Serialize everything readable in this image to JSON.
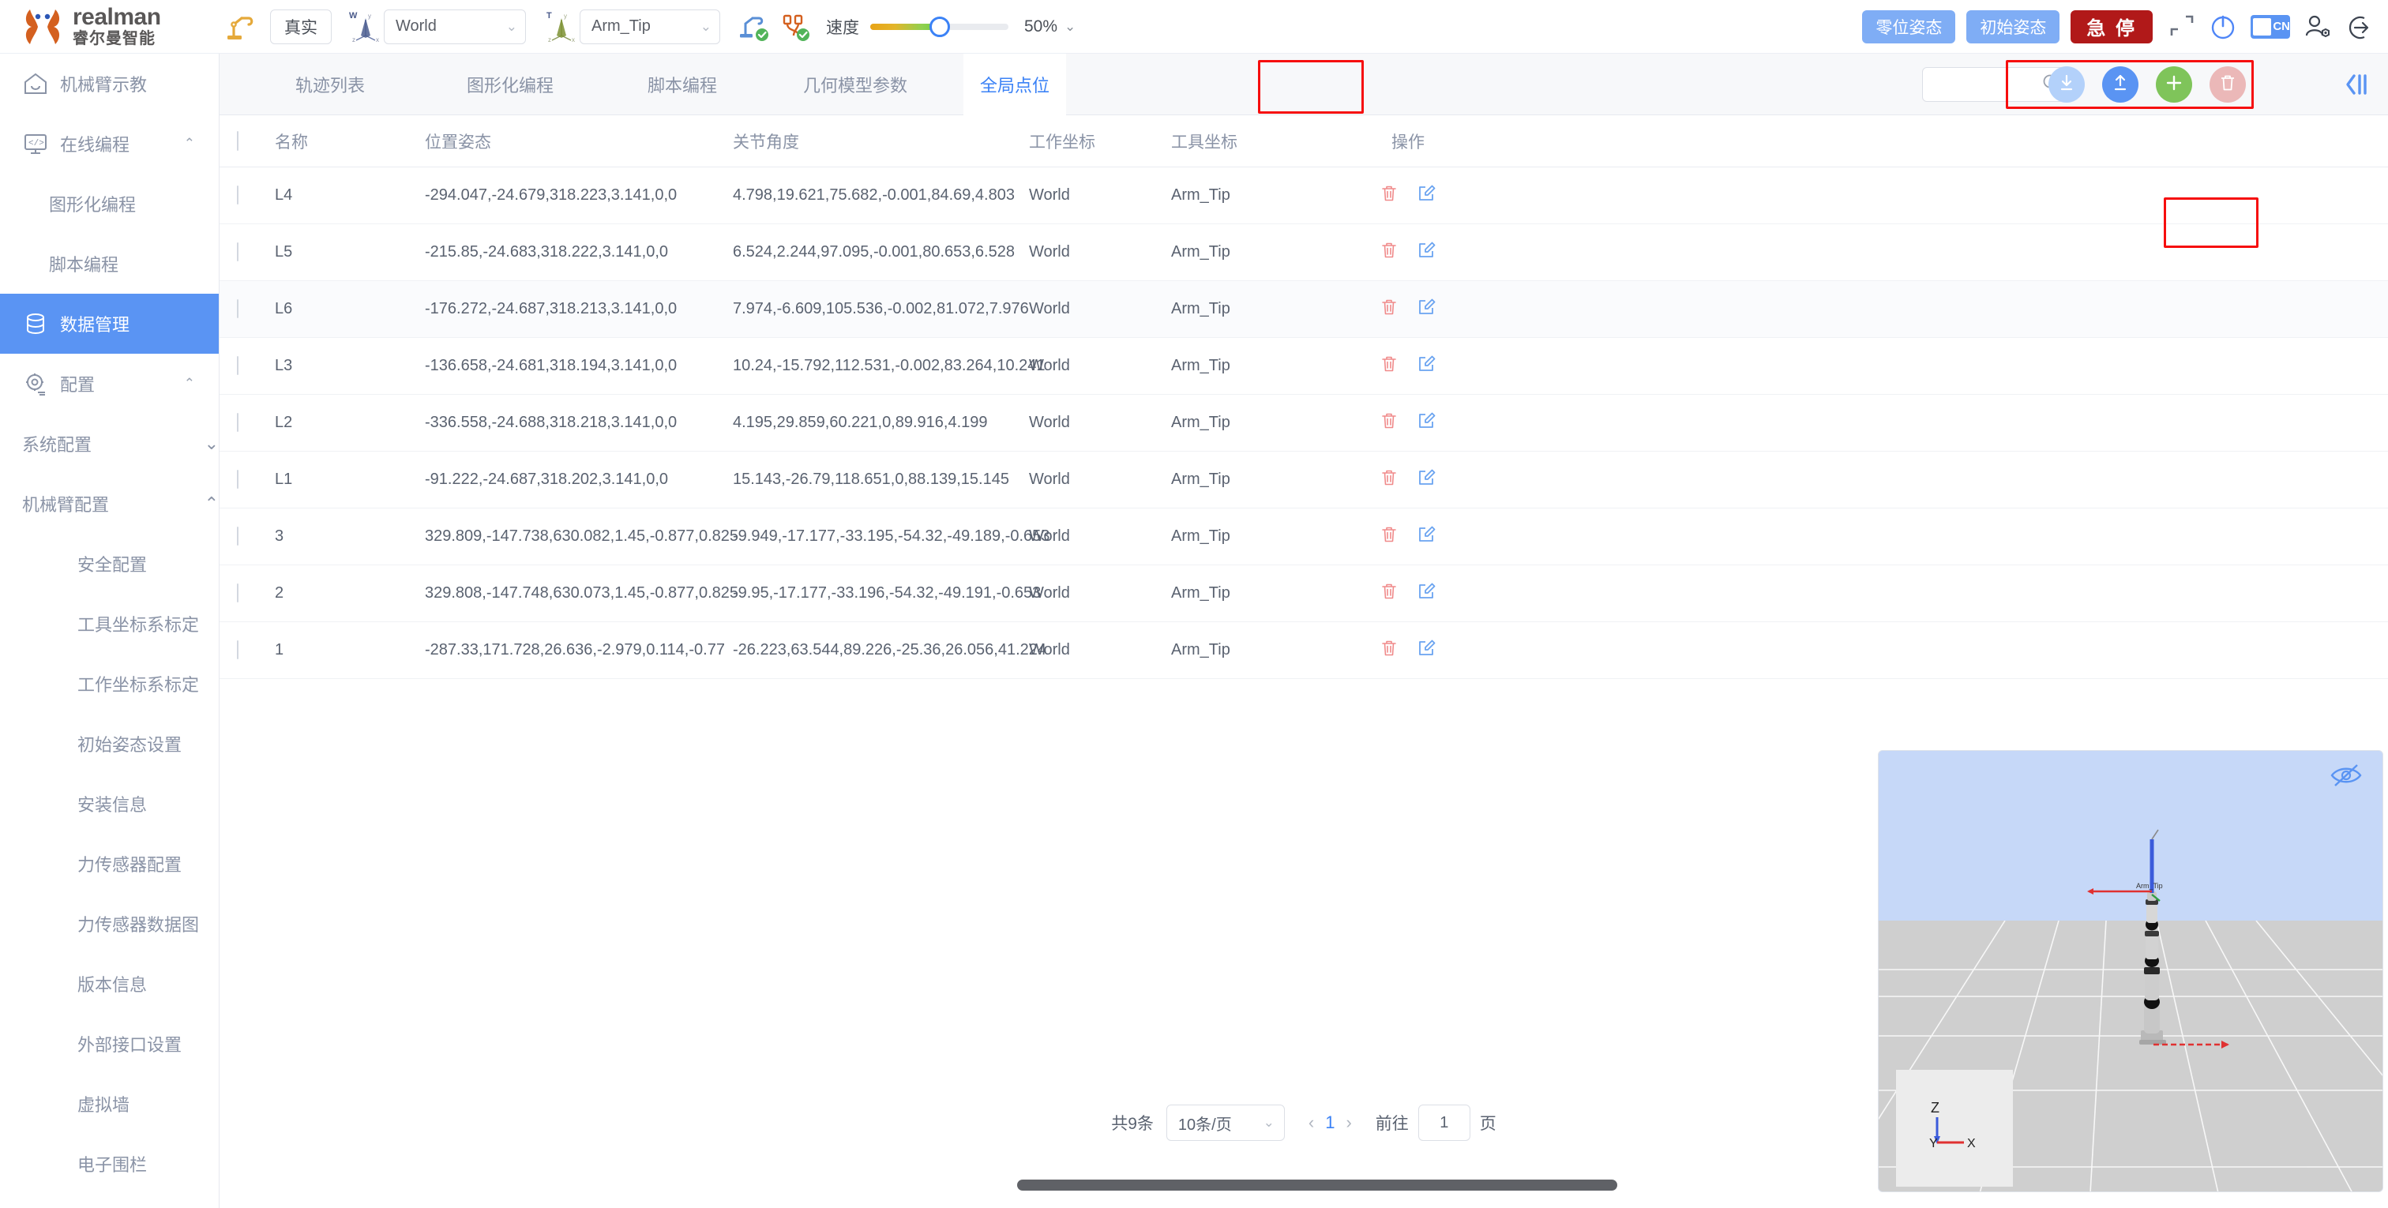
{
  "brand": {
    "name_en": "realman",
    "name_cn": "睿尔曼智能",
    "logo_icon": "realman-logo"
  },
  "topbar": {
    "robot_icon": "robot-arm-icon",
    "mode_button": "真实",
    "work_frame": {
      "icon": "world-axis-icon",
      "label": "W",
      "value": "World",
      "chevron": "chevron-down-icon"
    },
    "tool_frame": {
      "icon": "tool-axis-icon",
      "label": "T",
      "value": "Arm_Tip",
      "chevron": "chevron-down-icon"
    },
    "status_icons": [
      {
        "name": "robot-connected-icon",
        "state": "ok"
      },
      {
        "name": "controller-connected-icon",
        "state": "ok"
      }
    ],
    "speed_label": "速度",
    "speed_percent": "50%",
    "speed_value": 50,
    "speed_chevron": "chevron-down-icon",
    "zero_pose_button": "零位姿态",
    "init_pose_button": "初始姿态",
    "estop_button": "急 停",
    "fullscreen_icon": "fullscreen-icon",
    "power_icon": "power-icon",
    "language_chip": "CN",
    "user_icon": "user-settings-icon",
    "logout_icon": "logout-icon"
  },
  "sidebar": {
    "items": [
      {
        "label": "机械臂示教",
        "icon": "home-icon",
        "level": 0,
        "active": false,
        "arrow": ""
      },
      {
        "label": "在线编程",
        "icon": "code-monitor-icon",
        "level": 0,
        "active": false,
        "arrow": "⌃"
      },
      {
        "label": "图形化编程",
        "icon": "",
        "level": 1,
        "active": false,
        "arrow": ""
      },
      {
        "label": "脚本编程",
        "icon": "",
        "level": 1,
        "active": false,
        "arrow": ""
      },
      {
        "label": "数据管理",
        "icon": "database-icon",
        "level": 0,
        "active": true,
        "arrow": ""
      },
      {
        "label": "配置",
        "icon": "gear-icon",
        "level": 0,
        "active": false,
        "arrow": "⌃"
      },
      {
        "label": "系统配置",
        "icon": "",
        "level": 1,
        "active": false,
        "arrow": "⌄"
      },
      {
        "label": "机械臂配置",
        "icon": "",
        "level": 1,
        "active": false,
        "arrow": "⌃"
      },
      {
        "label": "安全配置",
        "icon": "",
        "level": 2,
        "active": false,
        "arrow": ""
      },
      {
        "label": "工具坐标系标定",
        "icon": "",
        "level": 2,
        "active": false,
        "arrow": ""
      },
      {
        "label": "工作坐标系标定",
        "icon": "",
        "level": 2,
        "active": false,
        "arrow": ""
      },
      {
        "label": "初始姿态设置",
        "icon": "",
        "level": 2,
        "active": false,
        "arrow": ""
      },
      {
        "label": "安装信息",
        "icon": "",
        "level": 2,
        "active": false,
        "arrow": ""
      },
      {
        "label": "力传感器配置",
        "icon": "",
        "level": 2,
        "active": false,
        "arrow": ""
      },
      {
        "label": "力传感器数据图",
        "icon": "",
        "level": 2,
        "active": false,
        "arrow": ""
      },
      {
        "label": "版本信息",
        "icon": "",
        "level": 2,
        "active": false,
        "arrow": ""
      },
      {
        "label": "外部接口设置",
        "icon": "",
        "level": 2,
        "active": false,
        "arrow": ""
      },
      {
        "label": "虚拟墙",
        "icon": "",
        "level": 2,
        "active": false,
        "arrow": ""
      },
      {
        "label": "电子围栏",
        "icon": "",
        "level": 2,
        "active": false,
        "arrow": ""
      }
    ]
  },
  "tabs": [
    {
      "label": "轨迹列表",
      "active": false
    },
    {
      "label": "图形化编程",
      "active": false
    },
    {
      "label": "脚本编程",
      "active": false
    },
    {
      "label": "几何模型参数",
      "active": false
    },
    {
      "label": "全局点位",
      "active": true
    }
  ],
  "toolbar": {
    "search_placeholder": "",
    "search_value": "",
    "search_icon": "search-icon",
    "actions": [
      {
        "name": "download-button",
        "icon": "download-icon",
        "color": "#b3d1fa"
      },
      {
        "name": "upload-button",
        "icon": "upload-icon",
        "color": "#5a94f3"
      },
      {
        "name": "add-button",
        "icon": "plus-icon",
        "color": "#7fc45a"
      },
      {
        "name": "delete-button",
        "icon": "trash-icon",
        "color": "#ebb8b8"
      }
    ],
    "collapse_icon": "collapse-panel-icon"
  },
  "table": {
    "columns": [
      "名称",
      "位置姿态",
      "关节角度",
      "工作坐标",
      "工具坐标",
      "操作"
    ],
    "rows": [
      {
        "name": "L4",
        "pose": "-294.047,-24.679,318.223,3.141,0,0",
        "joint": "4.798,19.621,75.682,-0.001,84.69,4.803",
        "work": "World",
        "tool": "Arm_Tip"
      },
      {
        "name": "L5",
        "pose": "-215.85,-24.683,318.222,3.141,0,0",
        "joint": "6.524,2.244,97.095,-0.001,80.653,6.528",
        "work": "World",
        "tool": "Arm_Tip"
      },
      {
        "name": "L6",
        "pose": "-176.272,-24.687,318.213,3.141,0,0",
        "joint": "7.974,-6.609,105.536,-0.002,81.072,7.976",
        "work": "World",
        "tool": "Arm_Tip"
      },
      {
        "name": "L3",
        "pose": "-136.658,-24.681,318.194,3.141,0,0",
        "joint": "10.24,-15.792,112.531,-0.002,83.264,10.241",
        "work": "World",
        "tool": "Arm_Tip"
      },
      {
        "name": "L2",
        "pose": "-336.558,-24.688,318.218,3.141,0,0",
        "joint": "4.195,29.859,60.221,0,89.916,4.199",
        "work": "World",
        "tool": "Arm_Tip"
      },
      {
        "name": "L1",
        "pose": "-91.222,-24.687,318.202,3.141,0,0",
        "joint": "15.143,-26.79,118.651,0,88.139,15.145",
        "work": "World",
        "tool": "Arm_Tip"
      },
      {
        "name": "3",
        "pose": "329.809,-147.738,630.082,1.45,-0.877,0.825",
        "joint": "-9.949,-17.177,-33.195,-54.32,-49.189,-0.653",
        "work": "World",
        "tool": "Arm_Tip"
      },
      {
        "name": "2",
        "pose": "329.808,-147.748,630.073,1.45,-0.877,0.825",
        "joint": "-9.95,-17.177,-33.196,-54.32,-49.191,-0.653",
        "work": "World",
        "tool": "Arm_Tip"
      },
      {
        "name": "1",
        "pose": "-287.33,171.728,26.636,-2.979,0.114,-0.77",
        "joint": "-26.223,63.544,89.226,-25.36,26.056,41.224",
        "work": "World",
        "tool": "Arm_Tip"
      }
    ],
    "row_actions": {
      "delete_icon": "trash-icon",
      "edit_icon": "edit-icon"
    }
  },
  "pagination": {
    "total_text": "共9条",
    "page_size": "10条/页",
    "page_size_chevron": "chevron-down-icon",
    "prev_icon": "chevron-left-icon",
    "next_icon": "chevron-right-icon",
    "current_page": "1",
    "goto_label": "前往",
    "goto_value": "1",
    "page_unit": "页"
  },
  "viewport": {
    "eye_icon": "eye-hidden-icon",
    "axis_labels": {
      "z": "Z",
      "y": "Y",
      "x": "X"
    },
    "arm_label": "Arm_Tip"
  },
  "colors": {
    "accent": "#3b82f6",
    "sidebar_active": "#5a94f3",
    "estop": "#b11919",
    "highlight_box": "#f60e0e",
    "add_green": "#7fc45a"
  }
}
